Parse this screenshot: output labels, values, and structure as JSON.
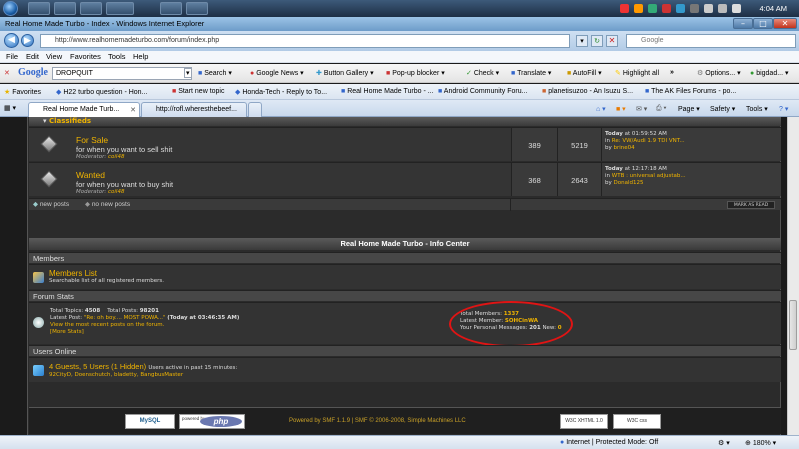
{
  "taskbar": {
    "clock": "4:04 AM"
  },
  "window": {
    "title": "Real Home Made Turbo - Index - Windows Internet Explorer",
    "min": "–",
    "max": "□",
    "close": "✕"
  },
  "address": {
    "url": "http://www.realhomemadeturbo.com/forum/index.php",
    "search_placeholder": "Google"
  },
  "menu": [
    "File",
    "Edit",
    "View",
    "Favorites",
    "Tools",
    "Help"
  ],
  "google_toolbar": {
    "logo": "Google",
    "query": "DROPQUIT",
    "items": [
      "Search",
      "Google News",
      "Button Gallery",
      "Pop-up blocker",
      "Check",
      "Translate",
      "AutoFill",
      "Highlight all",
      "»",
      "Options...",
      "bigdad..."
    ]
  },
  "favorites": {
    "label": "Favorites",
    "items": [
      "H22 turbo question - Hon...",
      "Start new topic",
      "Honda-Tech - Reply to To...",
      "Real Home Made Turbo - ...",
      "Android Community Foru...",
      "planetisuzoo - An Isuzu S...",
      "The AK Files Forums - po..."
    ]
  },
  "tabs": [
    {
      "label": "Real Home Made Turb..."
    },
    {
      "label": "http://rofl.wheresthebeef..."
    }
  ],
  "commands": [
    "Page ▾",
    "Safety ▾",
    "Tools ▾"
  ],
  "forum": {
    "category": "Classifieds",
    "boards": [
      {
        "title": "For Sale",
        "desc": "for when you want to sell shit",
        "mod_label": "Moderator:",
        "mod": "coil48",
        "topics": "389",
        "posts": "5219",
        "last_when": "Today",
        "last_time": "at 01:59:52 AM",
        "last_in": "in",
        "last_topic": "Re: VW/Audi 1.9 TDI VNT...",
        "last_by_label": "by",
        "last_by": "brine04"
      },
      {
        "title": "Wanted",
        "desc": "for when you want to buy shit",
        "mod_label": "Moderator:",
        "mod": "coil48",
        "topics": "368",
        "posts": "2643",
        "last_when": "Today",
        "last_time": "at 12:17:18 AM",
        "last_in": "in",
        "last_topic": "WTB : universal adjustab...",
        "last_by_label": "by",
        "last_by": "Donald125"
      }
    ],
    "legend_new": "new posts",
    "legend_none": "no new posts",
    "mark_read": "MARK AS READ",
    "info_center": "Real Home Made Turbo - Info Center",
    "members_header": "Members",
    "members_list": "Members List",
    "members_list_desc": "Searchable list of all registered members.",
    "stats_header": "Forum Stats",
    "stats": {
      "topics_label": "Total Topics:",
      "topics": "4508",
      "posts_label": "Total Posts:",
      "posts": "98201",
      "latest_post_label": "Latest Post:",
      "latest_post": "\"Re: oh boy.... MOST POWA...\"",
      "latest_post_time": "(Today at 03:46:35 AM)",
      "recent_link": "View the most recent posts on the forum.",
      "more_stats": "[More Stats]",
      "members_label": "Total Members:",
      "members": "1337",
      "latest_member_label": "Latest Member:",
      "latest_member": "SOHCinWA",
      "pm_label": "Your Personal Messages:",
      "pm_count": "201",
      "new_label": "New:",
      "new_count": "0"
    },
    "online_header": "Users Online",
    "online": {
      "summary": "4 Guests, 5 Users (1 Hidden)",
      "period": "Users active in past 15 minutes:",
      "users": "92CityD, Doenschutch, bladetty, BangbusMaster"
    },
    "footer": {
      "mysql": "MySQL",
      "powered_by": "powered by",
      "php": "php",
      "credit": "Powered by SMF 1.1.9 | SMF © 2006-2008, Simple Machines LLC",
      "xhtml": "W3C XHTML 1.0",
      "css": "W3C css"
    }
  },
  "status": {
    "zone": "Internet | Protected Mode: Off",
    "zoom": "180%"
  }
}
